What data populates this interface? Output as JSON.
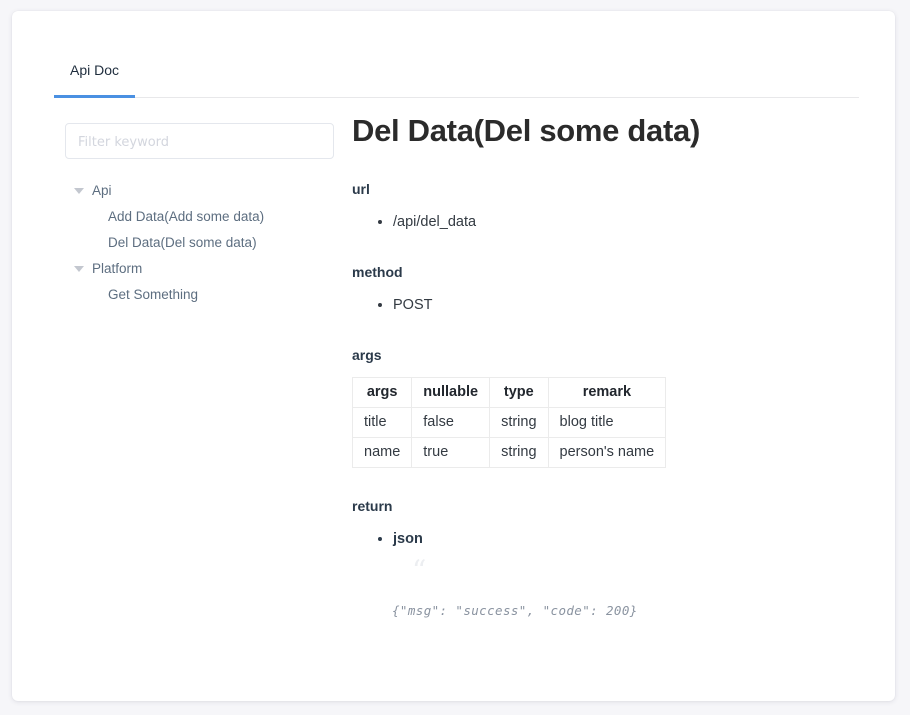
{
  "tabs": [
    {
      "label": "Api Doc",
      "active": true
    }
  ],
  "sidebar": {
    "filter": {
      "value": "",
      "placeholder": "Filter keyword"
    },
    "tree": [
      {
        "label": "Api",
        "expanded": true,
        "children": [
          {
            "label": "Add Data(Add some data)"
          },
          {
            "label": "Del Data(Del some data)"
          }
        ]
      },
      {
        "label": "Platform",
        "expanded": true,
        "children": [
          {
            "label": "Get Something"
          }
        ]
      }
    ]
  },
  "doc": {
    "title": "Del Data(Del some data)",
    "sections": {
      "url": {
        "label": "url",
        "items": [
          "/api/del_data"
        ]
      },
      "method": {
        "label": "method",
        "items": [
          "POST"
        ]
      },
      "args": {
        "label": "args",
        "table": {
          "headers": [
            "args",
            "nullable",
            "type",
            "remark"
          ],
          "rows": [
            [
              "title",
              "false",
              "string",
              "blog title"
            ],
            [
              "name",
              "true",
              "string",
              "person's name"
            ]
          ]
        }
      },
      "return": {
        "label": "return",
        "items": [
          "json"
        ],
        "quote_mark": "“",
        "code": "{\"msg\": \"success\", \"code\": 200}"
      }
    }
  },
  "colors": {
    "accent": "#4a90e2",
    "text": "#333a42",
    "muted": "#5d6e80",
    "background": "#f6f6f9",
    "card": "#ffffff",
    "border": "#ebebeb"
  }
}
